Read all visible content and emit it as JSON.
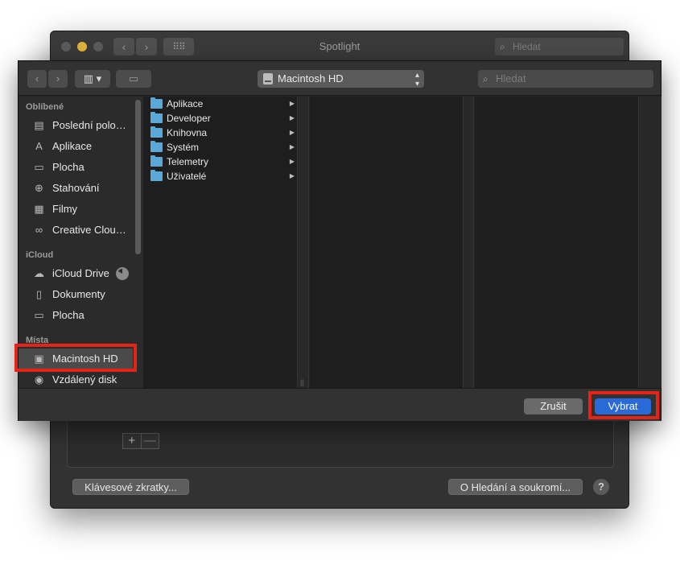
{
  "background_window": {
    "title": "Spotlight",
    "search_placeholder": "Hledat",
    "add_symbol": "+",
    "remove_symbol": "—",
    "shortcuts_button": "Klávesové zkratky...",
    "privacy_button": "O Hledání a soukromí...",
    "help_symbol": "?"
  },
  "dialog": {
    "view_toggle": "▥ ▾",
    "location_popup": "Macintosh HD",
    "search_placeholder": "Hledat",
    "sidebar": {
      "favorites_header": "Oblíbené",
      "favorites": [
        {
          "label": "Poslední polo…",
          "icon": "recents-icon"
        },
        {
          "label": "Aplikace",
          "icon": "applications-icon"
        },
        {
          "label": "Plocha",
          "icon": "desktop-icon"
        },
        {
          "label": "Stahování",
          "icon": "downloads-icon"
        },
        {
          "label": "Filmy",
          "icon": "movies-icon"
        },
        {
          "label": "Creative Clou…",
          "icon": "creative-cloud-icon"
        }
      ],
      "icloud_header": "iCloud",
      "icloud": [
        {
          "label": "iCloud Drive",
          "icon": "cloud-icon"
        },
        {
          "label": "Dokumenty",
          "icon": "documents-icon"
        },
        {
          "label": "Plocha",
          "icon": "desktop-icon"
        }
      ],
      "places_header": "Místa",
      "places": [
        {
          "label": "Macintosh HD",
          "icon": "hard-disk-icon",
          "selected": true
        },
        {
          "label": "Vzdálený disk",
          "icon": "remote-disc-icon"
        }
      ]
    },
    "column1_items": [
      "Aplikace",
      "Developer",
      "Knihovna",
      "Systém",
      "Telemetry",
      "Uživatelé"
    ],
    "cancel_button": "Zrušit",
    "choose_button": "Vybrat"
  },
  "colors": {
    "accent": "#2a6ad8",
    "highlight_annotation": "#e32417",
    "folder": "#59a8d8"
  }
}
